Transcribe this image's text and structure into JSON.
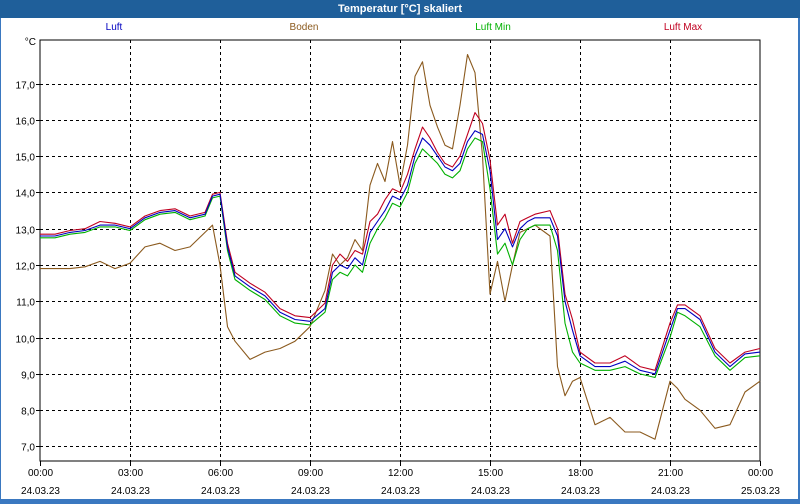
{
  "window": {
    "title": "Temperatur [°C] skaliert"
  },
  "chart_data": {
    "type": "line",
    "title": "Temperatur [°C] skaliert",
    "ylabel": "°C",
    "ylim": [
      6.6,
      18.2
    ],
    "yticks": [
      "7,0",
      "8,0",
      "9,0",
      "10,0",
      "11,0",
      "12,0",
      "13,0",
      "14,0",
      "15,0",
      "16,0",
      "17,0"
    ],
    "xlim": [
      0,
      24
    ],
    "xticks": [
      {
        "time": "00:00",
        "date": "24.03.23"
      },
      {
        "time": "03:00",
        "date": "24.03.23"
      },
      {
        "time": "06:00",
        "date": "24.03.23"
      },
      {
        "time": "09:00",
        "date": "24.03.23"
      },
      {
        "time": "12:00",
        "date": "24.03.23"
      },
      {
        "time": "15:00",
        "date": "24.03.23"
      },
      {
        "time": "18:00",
        "date": "24.03.23"
      },
      {
        "time": "21:00",
        "date": "24.03.23"
      },
      {
        "time": "00:00",
        "date": "25.03.23"
      }
    ],
    "grid": true,
    "legend_position": "top",
    "series": [
      {
        "name": "Luft",
        "color": "#0000c0",
        "x": [
          0,
          0.5,
          1,
          1.5,
          2,
          2.5,
          3,
          3.5,
          4,
          4.5,
          5,
          5.5,
          5.75,
          6,
          6.25,
          6.5,
          7,
          7.5,
          8,
          8.5,
          9,
          9.5,
          9.75,
          10,
          10.25,
          10.5,
          10.75,
          11,
          11.25,
          11.5,
          11.75,
          12,
          12.25,
          12.5,
          12.75,
          13,
          13.25,
          13.5,
          13.75,
          14,
          14.25,
          14.5,
          14.75,
          15,
          15.25,
          15.5,
          15.75,
          16,
          16.25,
          16.5,
          17,
          17.25,
          17.5,
          17.75,
          18,
          18.5,
          19,
          19.5,
          20,
          20.5,
          21,
          21.25,
          21.5,
          22,
          22.5,
          23,
          23.5,
          24
        ],
        "y": [
          12.8,
          12.8,
          12.9,
          12.95,
          13.1,
          13.1,
          13.0,
          13.3,
          13.45,
          13.5,
          13.3,
          13.4,
          13.9,
          13.95,
          12.5,
          11.7,
          11.4,
          11.15,
          10.7,
          10.5,
          10.45,
          10.8,
          11.8,
          12.0,
          11.9,
          12.2,
          12.0,
          12.9,
          13.2,
          13.5,
          13.9,
          13.8,
          14.2,
          15.0,
          15.5,
          15.3,
          15.0,
          14.7,
          14.6,
          14.8,
          15.4,
          15.7,
          15.6,
          14.6,
          12.7,
          13.0,
          12.5,
          13.0,
          13.2,
          13.3,
          13.3,
          12.8,
          11.0,
          10.2,
          9.5,
          9.2,
          9.2,
          9.35,
          9.1,
          9.0,
          10.2,
          10.8,
          10.8,
          10.5,
          9.6,
          9.2,
          9.55,
          9.6
        ]
      },
      {
        "name": "Boden",
        "color": "#8b5a1e",
        "x": [
          0,
          0.5,
          1,
          1.5,
          2,
          2.5,
          3,
          3.5,
          4,
          4.5,
          5,
          5.5,
          5.75,
          6,
          6.25,
          6.5,
          7,
          7.5,
          8,
          8.5,
          9,
          9.5,
          9.75,
          10,
          10.25,
          10.5,
          10.75,
          11,
          11.25,
          11.5,
          11.75,
          12,
          12.25,
          12.5,
          12.75,
          13,
          13.25,
          13.5,
          13.75,
          14,
          14.25,
          14.5,
          14.75,
          15,
          15.25,
          15.5,
          15.75,
          16,
          16.25,
          16.5,
          17,
          17.25,
          17.5,
          17.75,
          18,
          18.5,
          19,
          19.5,
          20,
          20.5,
          21,
          21.25,
          21.5,
          22,
          22.5,
          23,
          23.5,
          24
        ],
        "y": [
          11.9,
          11.9,
          11.9,
          11.95,
          12.1,
          11.9,
          12.05,
          12.5,
          12.6,
          12.4,
          12.5,
          12.9,
          13.1,
          12.0,
          10.3,
          9.9,
          9.4,
          9.6,
          9.7,
          9.9,
          10.3,
          11.3,
          12.3,
          12.0,
          12.2,
          12.7,
          12.4,
          14.2,
          14.8,
          14.3,
          15.4,
          14.2,
          15.3,
          17.2,
          17.6,
          16.4,
          15.8,
          15.3,
          15.2,
          16.4,
          17.8,
          17.3,
          15.0,
          11.2,
          12.1,
          11.0,
          12.0,
          12.9,
          13.0,
          13.1,
          12.8,
          9.2,
          8.4,
          8.8,
          8.9,
          7.6,
          7.8,
          7.4,
          7.4,
          7.2,
          8.8,
          8.6,
          8.3,
          8.0,
          7.5,
          7.6,
          8.5,
          8.8
        ]
      },
      {
        "name": "Luft Min",
        "color": "#00b000",
        "x": [
          0,
          0.5,
          1,
          1.5,
          2,
          2.5,
          3,
          3.5,
          4,
          4.5,
          5,
          5.5,
          5.75,
          6,
          6.25,
          6.5,
          7,
          7.5,
          8,
          8.5,
          9,
          9.5,
          9.75,
          10,
          10.25,
          10.5,
          10.75,
          11,
          11.25,
          11.5,
          11.75,
          12,
          12.25,
          12.5,
          12.75,
          13,
          13.25,
          13.5,
          13.75,
          14,
          14.25,
          14.5,
          14.75,
          15,
          15.25,
          15.5,
          15.75,
          16,
          16.25,
          16.5,
          17,
          17.25,
          17.5,
          17.75,
          18,
          18.5,
          19,
          19.5,
          20,
          20.5,
          21,
          21.25,
          21.5,
          22,
          22.5,
          23,
          23.5,
          24
        ],
        "y": [
          12.75,
          12.75,
          12.85,
          12.9,
          13.05,
          13.05,
          12.95,
          13.25,
          13.4,
          13.45,
          13.25,
          13.35,
          13.85,
          13.9,
          12.4,
          11.6,
          11.3,
          11.05,
          10.6,
          10.4,
          10.35,
          10.7,
          11.6,
          11.8,
          11.7,
          12.0,
          11.8,
          12.6,
          13.0,
          13.3,
          13.7,
          13.6,
          14.0,
          14.8,
          15.2,
          15.0,
          14.8,
          14.5,
          14.4,
          14.6,
          15.2,
          15.5,
          15.4,
          14.1,
          12.3,
          12.6,
          12.0,
          12.7,
          13.0,
          13.1,
          13.1,
          12.4,
          10.4,
          9.6,
          9.3,
          9.1,
          9.1,
          9.2,
          9.0,
          8.9,
          10.0,
          10.7,
          10.6,
          10.3,
          9.5,
          9.1,
          9.45,
          9.5
        ]
      },
      {
        "name": "Luft Max",
        "color": "#c00020",
        "x": [
          0,
          0.5,
          1,
          1.5,
          2,
          2.5,
          3,
          3.5,
          4,
          4.5,
          5,
          5.5,
          5.75,
          6,
          6.25,
          6.5,
          7,
          7.5,
          8,
          8.5,
          9,
          9.5,
          9.75,
          10,
          10.25,
          10.5,
          10.75,
          11,
          11.25,
          11.5,
          11.75,
          12,
          12.25,
          12.5,
          12.75,
          13,
          13.25,
          13.5,
          13.75,
          14,
          14.25,
          14.5,
          14.75,
          15,
          15.25,
          15.5,
          15.75,
          16,
          16.25,
          16.5,
          17,
          17.25,
          17.5,
          17.75,
          18,
          18.5,
          19,
          19.5,
          20,
          20.5,
          21,
          21.25,
          21.5,
          22,
          22.5,
          23,
          23.5,
          24
        ],
        "y": [
          12.85,
          12.85,
          12.95,
          13.0,
          13.2,
          13.15,
          13.05,
          13.35,
          13.5,
          13.55,
          13.35,
          13.45,
          13.95,
          14.0,
          12.6,
          11.8,
          11.5,
          11.25,
          10.8,
          10.6,
          10.55,
          10.95,
          12.0,
          12.3,
          12.1,
          12.4,
          12.3,
          13.2,
          13.4,
          13.8,
          14.1,
          14.0,
          14.5,
          15.2,
          15.8,
          15.5,
          15.1,
          14.8,
          14.7,
          15.0,
          15.6,
          16.2,
          15.9,
          14.9,
          13.1,
          13.4,
          12.6,
          13.2,
          13.3,
          13.4,
          13.5,
          13.0,
          11.2,
          10.5,
          9.6,
          9.3,
          9.3,
          9.5,
          9.2,
          9.1,
          10.4,
          10.9,
          10.9,
          10.6,
          9.7,
          9.3,
          9.6,
          9.7
        ]
      }
    ]
  }
}
